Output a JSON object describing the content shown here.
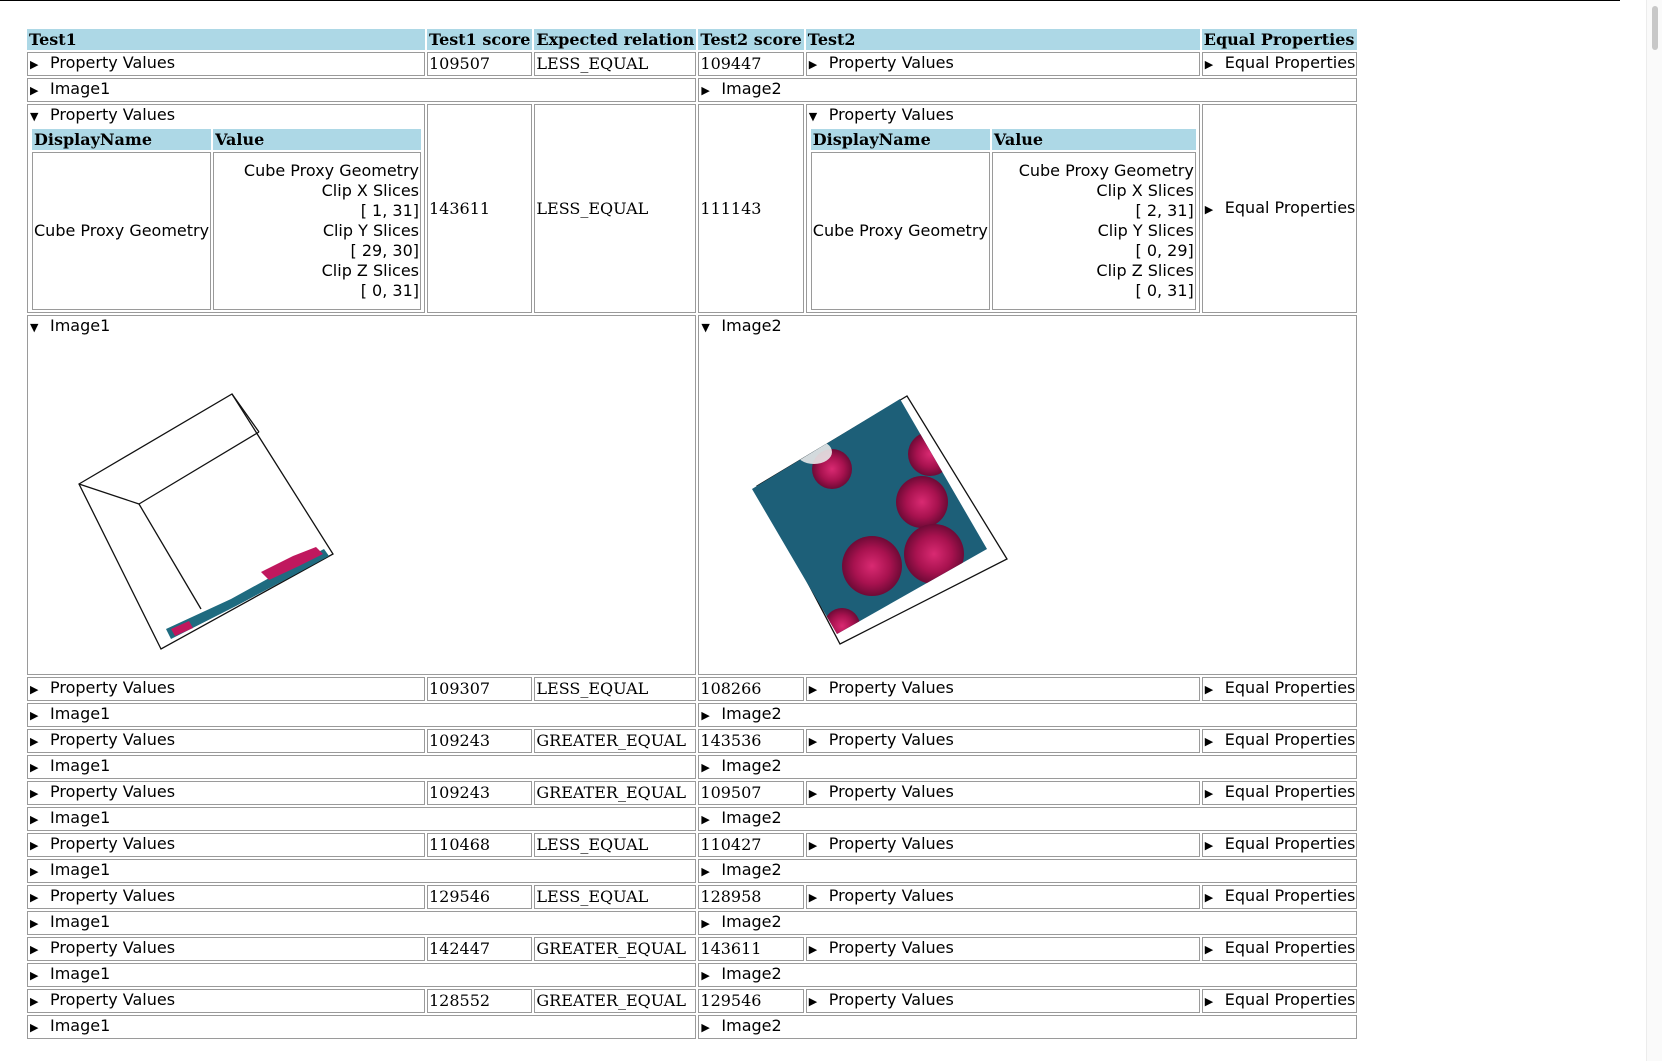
{
  "headers": [
    "Test1",
    "Test1 score",
    "Expected relation",
    "Test2 score",
    "Test2",
    "Equal Properties"
  ],
  "labels": {
    "property_values": "Property Values",
    "image1": "Image1",
    "image2": "Image2",
    "equal_properties": "Equal Properties",
    "display_name": "DisplayName",
    "value": "Value"
  },
  "rows": [
    {
      "s1": "109507",
      "rel": "LESS_EQUAL",
      "s2": "109447"
    },
    {
      "s1": "143611",
      "rel": "LESS_EQUAL",
      "s2": "111143"
    },
    {
      "s1": "109307",
      "rel": "LESS_EQUAL",
      "s2": "108266"
    },
    {
      "s1": "109243",
      "rel": "GREATER_EQUAL",
      "s2": "143536"
    },
    {
      "s1": "109243",
      "rel": "GREATER_EQUAL",
      "s2": "109507"
    },
    {
      "s1": "110468",
      "rel": "LESS_EQUAL",
      "s2": "110427"
    },
    {
      "s1": "129546",
      "rel": "LESS_EQUAL",
      "s2": "128958"
    },
    {
      "s1": "142447",
      "rel": "GREATER_EQUAL",
      "s2": "143611"
    },
    {
      "s1": "128552",
      "rel": "GREATER_EQUAL",
      "s2": "129546"
    }
  ],
  "expanded": {
    "test1": {
      "display_name": "Cube Proxy Geometry",
      "value_lines": [
        "Cube Proxy Geometry",
        "Clip X Slices",
        "[ 1, 31]",
        "Clip Y Slices",
        "[ 29, 30]",
        "Clip Z Slices",
        "[ 0, 31]"
      ]
    },
    "test2": {
      "display_name": "Cube Proxy Geometry",
      "value_lines": [
        "Cube Proxy Geometry",
        "Clip X Slices",
        "[ 2, 31]",
        "Clip Y Slices",
        "[ 0, 29]",
        "Clip Z Slices",
        "[ 0, 31]"
      ]
    }
  },
  "icons": {
    "collapsed": "triangle-right-icon",
    "expanded": "triangle-down-icon"
  },
  "colors": {
    "header_bg": "#add8e6",
    "volume_teal": "#2a6f85",
    "volume_magenta": "#b0185a"
  }
}
